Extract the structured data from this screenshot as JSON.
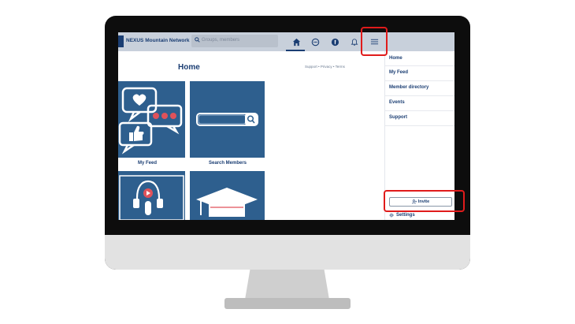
{
  "topnav": {
    "brand": "NEXUS Mountain Network",
    "search_placeholder": "Groups, members",
    "icons": [
      "home-icon",
      "chat-icon",
      "nexus-logo-icon",
      "bell-icon",
      "menu-icon"
    ]
  },
  "content": {
    "title": "Home",
    "links": "Support  •  Privacy  •  Terms",
    "tiles": [
      {
        "label": "My Feed"
      },
      {
        "label": "Search Members"
      },
      {
        "label": ""
      },
      {
        "label": ""
      }
    ]
  },
  "sidebar": {
    "items": [
      {
        "label": "Home"
      },
      {
        "label": "My Feed"
      },
      {
        "label": "Member directory"
      },
      {
        "label": "Events"
      },
      {
        "label": "Support"
      }
    ],
    "invite_label": "Invite",
    "settings_label": "Settings"
  },
  "colors": {
    "brand": "#1b3e73",
    "tile": "#2e5f8e",
    "highlight": "#e01b1b",
    "accent": "#e0525a"
  }
}
